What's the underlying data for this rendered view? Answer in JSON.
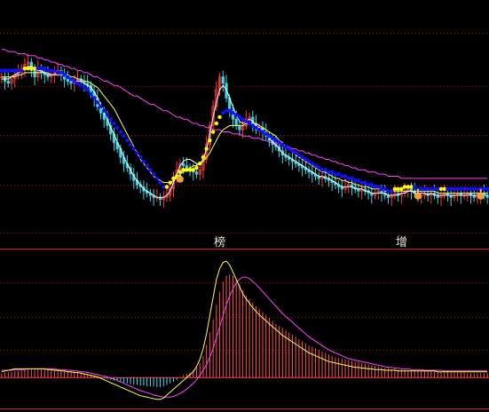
{
  "chart_data": [
    {
      "type": "candlestick",
      "panel": "price",
      "colors": {
        "up": "#ff3b3b",
        "down": "#38d6e6",
        "dotted_down": "#1010ff",
        "dotted_up": "#ffff00",
        "ma_short": "#ffffff",
        "ma_mid": "#ffff66",
        "ma_long": "#ff40ff",
        "grid": "#aa1010"
      },
      "annotations": [
        {
          "text": "榜",
          "at_bar": 66
        },
        {
          "text": "增",
          "at_bar": 121
        }
      ],
      "pointer_icons": [
        54,
        126,
        145
      ],
      "closes": [
        72,
        70,
        69,
        71,
        73,
        74,
        76,
        78,
        79,
        75,
        72,
        76,
        74,
        73,
        72,
        73,
        74,
        75,
        73,
        71,
        70,
        69,
        70,
        71,
        70,
        69,
        68,
        65,
        62,
        58,
        55,
        52,
        49,
        45,
        41,
        38,
        34,
        31,
        29,
        26,
        23,
        21,
        20,
        18,
        17,
        16,
        15,
        15,
        14,
        15,
        16,
        19,
        24,
        28,
        31,
        30,
        29,
        28,
        27,
        26,
        28,
        33,
        40,
        49,
        58,
        66,
        72,
        69,
        62,
        56,
        52,
        49,
        47,
        49,
        52,
        53,
        50,
        47,
        48,
        46,
        44,
        42,
        40,
        39,
        37,
        35,
        34,
        33,
        32,
        31,
        30,
        29,
        28,
        27,
        26,
        25,
        24,
        25,
        24,
        23,
        22,
        21,
        20,
        19,
        20,
        21,
        20,
        19,
        18,
        19,
        18,
        17,
        16,
        17,
        18,
        17,
        16,
        15,
        16,
        17,
        16,
        17,
        18,
        19,
        18,
        17,
        16,
        16,
        17,
        16,
        17,
        16,
        15,
        16,
        17,
        16,
        15,
        16,
        17,
        16,
        16,
        17,
        16,
        15,
        16,
        17,
        16,
        15
      ],
      "ma_short": [
        71,
        71,
        71,
        72,
        73,
        74,
        75,
        76,
        77,
        77,
        76,
        75,
        75,
        74,
        73,
        73,
        73,
        74,
        74,
        73,
        72,
        71,
        70,
        70,
        70,
        69,
        68,
        67,
        65,
        62,
        59,
        55,
        52,
        48,
        45,
        41,
        38,
        34,
        31,
        28,
        25,
        23,
        21,
        19,
        18,
        17,
        16,
        15,
        15,
        15,
        16,
        18,
        22,
        26,
        30,
        32,
        33,
        33,
        32,
        31,
        31,
        33,
        38,
        45,
        53,
        60,
        66,
        68,
        66,
        62,
        58,
        54,
        51,
        50,
        51,
        52,
        51,
        49,
        48,
        47,
        45,
        43,
        41,
        40,
        38,
        36,
        35,
        34,
        33,
        32,
        31,
        30,
        29,
        28,
        27,
        26,
        25,
        25,
        24,
        24,
        23,
        22,
        21,
        20,
        20,
        20,
        20,
        19,
        19,
        19,
        18,
        18,
        17,
        17,
        17,
        17,
        17,
        16,
        16,
        16,
        16,
        17,
        17,
        18,
        18,
        17,
        17,
        17,
        17,
        16,
        17,
        16,
        16,
        16,
        16,
        16,
        16,
        16,
        16,
        16,
        16,
        16,
        16,
        16,
        16,
        16,
        16,
        16
      ],
      "ma_mid": [
        72,
        72,
        72,
        72,
        72,
        73,
        73,
        74,
        74,
        74,
        74,
        74,
        74,
        74,
        74,
        73,
        73,
        73,
        73,
        73,
        73,
        72,
        72,
        71,
        71,
        70,
        70,
        69,
        68,
        67,
        65,
        63,
        61,
        59,
        57,
        54,
        51,
        48,
        45,
        42,
        39,
        36,
        33,
        31,
        29,
        27,
        25,
        24,
        23,
        22,
        22,
        22,
        23,
        24,
        26,
        27,
        28,
        29,
        30,
        30,
        31,
        32,
        34,
        36,
        39,
        42,
        45,
        47,
        48,
        49,
        49,
        49,
        49,
        49,
        50,
        50,
        50,
        50,
        49,
        48,
        47,
        46,
        45,
        44,
        42,
        41,
        39,
        38,
        37,
        35,
        34,
        33,
        32,
        31,
        30,
        29,
        28,
        27,
        27,
        26,
        25,
        24,
        24,
        23,
        23,
        22,
        22,
        21,
        21,
        20,
        20,
        20,
        19,
        19,
        19,
        19,
        18,
        18,
        18,
        18,
        18,
        18,
        18,
        18,
        18,
        18,
        18,
        18,
        18,
        18,
        18,
        18,
        17,
        17,
        17,
        17,
        17,
        17,
        17,
        17,
        17,
        17,
        17,
        17,
        17,
        17,
        17,
        17
      ],
      "ma_long": [
        85,
        85,
        84,
        84,
        84,
        83,
        83,
        83,
        82,
        82,
        82,
        81,
        81,
        80,
        80,
        79,
        79,
        78,
        78,
        77,
        77,
        76,
        76,
        75,
        75,
        74,
        74,
        73,
        72,
        72,
        71,
        70,
        70,
        69,
        68,
        68,
        67,
        66,
        65,
        64,
        63,
        63,
        62,
        61,
        60,
        59,
        59,
        58,
        57,
        56,
        56,
        55,
        54,
        53,
        53,
        52,
        52,
        51,
        50,
        50,
        49,
        49,
        48,
        48,
        47,
        47,
        47,
        46,
        46,
        46,
        45,
        45,
        45,
        44,
        44,
        44,
        43,
        43,
        43,
        42,
        42,
        41,
        41,
        41,
        40,
        40,
        39,
        39,
        38,
        38,
        37,
        37,
        36,
        36,
        35,
        35,
        34,
        34,
        33,
        33,
        32,
        32,
        31,
        31,
        30,
        30,
        29,
        29,
        28,
        28,
        28,
        27,
        27,
        27,
        26,
        26,
        26,
        25,
        25,
        25,
        25,
        24,
        24,
        24,
        24,
        24,
        24,
        24,
        24,
        24,
        24,
        24,
        24,
        24,
        24,
        24,
        24,
        24,
        24,
        24,
        24,
        24,
        24,
        24,
        24,
        24,
        24,
        24
      ],
      "trail": [
        75,
        75,
        75,
        75,
        75,
        75,
        75,
        76,
        76,
        76,
        76,
        76,
        76,
        76,
        75,
        75,
        75,
        74,
        74,
        73,
        72,
        71,
        70,
        69,
        68,
        67,
        66,
        64,
        62,
        60,
        58,
        56,
        54,
        52,
        50,
        48,
        46,
        44,
        42,
        40,
        38,
        36,
        34,
        32,
        30,
        28,
        26,
        24,
        22,
        20,
        20,
        22,
        24,
        25,
        27,
        28,
        28,
        28,
        28,
        29,
        31,
        34,
        38,
        42,
        46,
        50,
        53,
        55,
        56,
        56,
        55,
        54,
        53,
        52,
        51,
        50,
        49,
        48,
        47,
        46,
        45,
        44,
        43,
        42,
        41,
        40,
        39,
        38,
        37,
        36,
        35,
        34,
        33,
        32,
        31,
        30,
        29,
        28,
        28,
        27,
        27,
        26,
        26,
        25,
        25,
        24,
        24,
        23,
        23,
        22,
        22,
        21,
        21,
        20,
        20,
        19,
        19,
        18,
        18,
        19,
        19,
        19,
        20,
        20,
        20,
        20,
        19,
        19,
        19,
        19,
        19,
        19,
        19,
        19,
        19,
        19,
        19,
        19,
        19,
        19,
        19,
        19,
        19,
        19,
        19,
        19,
        19,
        19
      ],
      "trail_up": [
        false,
        false,
        false,
        false,
        false,
        false,
        false,
        true,
        true,
        true,
        true,
        false,
        false,
        false,
        false,
        false,
        false,
        false,
        false,
        false,
        false,
        false,
        false,
        false,
        false,
        false,
        false,
        false,
        false,
        false,
        false,
        false,
        false,
        false,
        false,
        false,
        false,
        false,
        false,
        false,
        false,
        false,
        false,
        false,
        false,
        false,
        false,
        false,
        false,
        false,
        true,
        true,
        true,
        true,
        true,
        true,
        true,
        true,
        true,
        true,
        true,
        true,
        true,
        true,
        true,
        true,
        true,
        false,
        false,
        false,
        false,
        false,
        false,
        false,
        false,
        false,
        false,
        false,
        false,
        false,
        false,
        false,
        false,
        false,
        false,
        false,
        false,
        false,
        false,
        false,
        false,
        false,
        false,
        false,
        false,
        false,
        false,
        false,
        false,
        false,
        false,
        false,
        false,
        false,
        false,
        false,
        false,
        false,
        false,
        false,
        false,
        false,
        false,
        false,
        false,
        false,
        false,
        false,
        false,
        true,
        true,
        true,
        true,
        true,
        true,
        false,
        false,
        false,
        false,
        false,
        false,
        false,
        false,
        true,
        true,
        false,
        false,
        false,
        false,
        false,
        false,
        false,
        false,
        false,
        false,
        false,
        false,
        false
      ]
    },
    {
      "type": "macd",
      "panel": "indicator",
      "colors": {
        "positive": "#ff5050",
        "negative": "#40e0ff",
        "dif": "#ffff44",
        "dea": "#ff40ff",
        "zero": "#ff4040",
        "grid": "#aa1010"
      },
      "zero_level": 0,
      "ylim": [
        -40,
        165
      ],
      "hist": [
        6,
        7,
        8,
        8,
        9,
        9,
        10,
        10,
        11,
        11,
        11,
        12,
        12,
        12,
        12,
        12,
        11,
        11,
        10,
        10,
        9,
        9,
        8,
        8,
        7,
        6,
        5,
        4,
        3,
        2,
        1,
        -1,
        -2,
        -3,
        -4,
        -5,
        -6,
        -7,
        -8,
        -9,
        -10,
        -10,
        -11,
        -11,
        -12,
        -12,
        -12,
        -13,
        -13,
        -12,
        -10,
        -8,
        -6,
        -3,
        0,
        3,
        5,
        7,
        10,
        14,
        20,
        30,
        45,
        62,
        80,
        100,
        118,
        132,
        140,
        142,
        140,
        135,
        128,
        120,
        113,
        108,
        103,
        98,
        94,
        90,
        86,
        82,
        78,
        74,
        71,
        68,
        65,
        62,
        59,
        56,
        53,
        50,
        47,
        44,
        42,
        40,
        38,
        36,
        34,
        32,
        30,
        28,
        27,
        26,
        25,
        24,
        23,
        22,
        21,
        20,
        19,
        18,
        17,
        16,
        15,
        14,
        13,
        13,
        12,
        12,
        11,
        11,
        11,
        10,
        10,
        10,
        10,
        9,
        9,
        9,
        9,
        8,
        8,
        8,
        8,
        8,
        7,
        7,
        7,
        7,
        7,
        6,
        6,
        6,
        6,
        6,
        6,
        6
      ],
      "dif": [
        8,
        9,
        10,
        11,
        12,
        12,
        12,
        12,
        12,
        12,
        12,
        12,
        12,
        12,
        11,
        11,
        10,
        10,
        9,
        9,
        8,
        8,
        7,
        7,
        6,
        5,
        4,
        3,
        2,
        1,
        -1,
        -3,
        -5,
        -7,
        -9,
        -11,
        -13,
        -15,
        -17,
        -19,
        -21,
        -23,
        -25,
        -26,
        -27,
        -28,
        -29,
        -30,
        -30,
        -28,
        -24,
        -20,
        -16,
        -12,
        -8,
        -4,
        0,
        4,
        8,
        15,
        25,
        40,
        60,
        85,
        110,
        135,
        150,
        158,
        160,
        155,
        145,
        135,
        125,
        115,
        108,
        102,
        96,
        91,
        86,
        82,
        78,
        74,
        70,
        66,
        62,
        58,
        55,
        52,
        49,
        46,
        43,
        40,
        37,
        34,
        32,
        30,
        28,
        26,
        24,
        22,
        21,
        20,
        19,
        18,
        17,
        16,
        15,
        14,
        14,
        13,
        13,
        12,
        12,
        11,
        11,
        11,
        10,
        10,
        10,
        10,
        9,
        9,
        9,
        9,
        9,
        9,
        9,
        9,
        9,
        9,
        9,
        9,
        8,
        8,
        8,
        8,
        8,
        8,
        8,
        8,
        8,
        8,
        8,
        8,
        8,
        8,
        8,
        8
      ],
      "dea": [
        10,
        10,
        10,
        10,
        11,
        11,
        11,
        11,
        12,
        12,
        12,
        12,
        12,
        12,
        12,
        12,
        12,
        11,
        11,
        11,
        10,
        10,
        9,
        9,
        8,
        8,
        7,
        6,
        5,
        4,
        3,
        2,
        1,
        -1,
        -2,
        -4,
        -6,
        -8,
        -10,
        -12,
        -14,
        -16,
        -18,
        -19,
        -21,
        -22,
        -24,
        -25,
        -26,
        -27,
        -27,
        -27,
        -26,
        -24,
        -22,
        -19,
        -16,
        -12,
        -8,
        -3,
        3,
        10,
        18,
        28,
        40,
        55,
        70,
        85,
        100,
        112,
        122,
        130,
        135,
        138,
        138,
        136,
        132,
        128,
        123,
        118,
        113,
        108,
        103,
        98,
        93,
        88,
        84,
        80,
        76,
        72,
        68,
        64,
        60,
        56,
        53,
        50,
        47,
        44,
        41,
        38,
        36,
        34,
        32,
        30,
        28,
        26,
        25,
        24,
        23,
        22,
        21,
        20,
        19,
        18,
        17,
        16,
        15,
        14,
        14,
        13,
        13,
        12,
        12,
        12,
        11,
        11,
        11,
        11,
        10,
        10,
        10,
        10,
        10,
        10,
        9,
        9,
        9,
        9,
        9,
        9,
        9,
        9,
        9,
        9,
        9,
        9,
        9,
        9
      ]
    }
  ]
}
